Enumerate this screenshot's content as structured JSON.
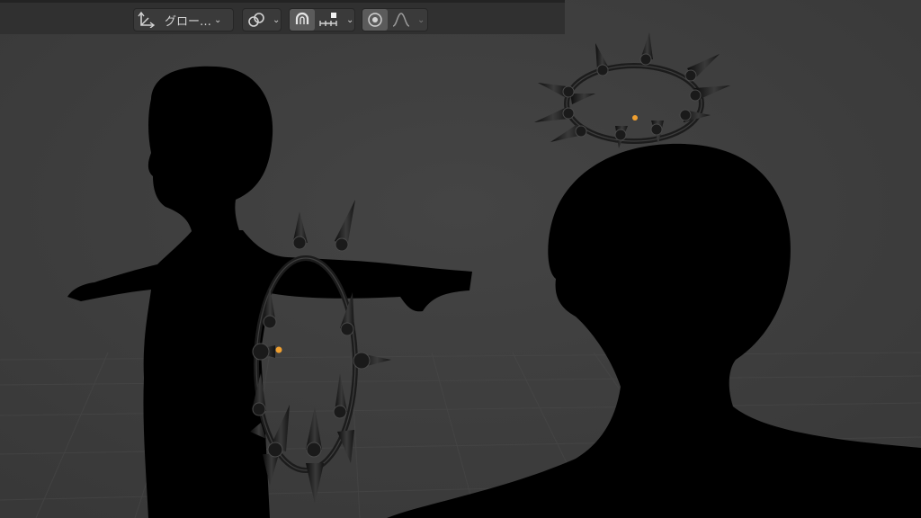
{
  "toolbar": {
    "transform_orientation": {
      "label": "グロー…",
      "icon": "transform-orientation-icon"
    },
    "pivot": {
      "icon": "pivot-link-icon"
    },
    "snapping": {
      "icon": "magnet-icon",
      "snap_target_icon": "snap-increment-icon"
    },
    "proportional_editing": {
      "icon": "proportional-edit-icon",
      "falloff_icon": "smooth-falloff-icon"
    }
  },
  "colors": {
    "background": "#3d3d3d",
    "header": "#303030",
    "origin_point": "#f0a030",
    "silhouette": "#000000",
    "spike_metal": "#1e1e1e"
  }
}
